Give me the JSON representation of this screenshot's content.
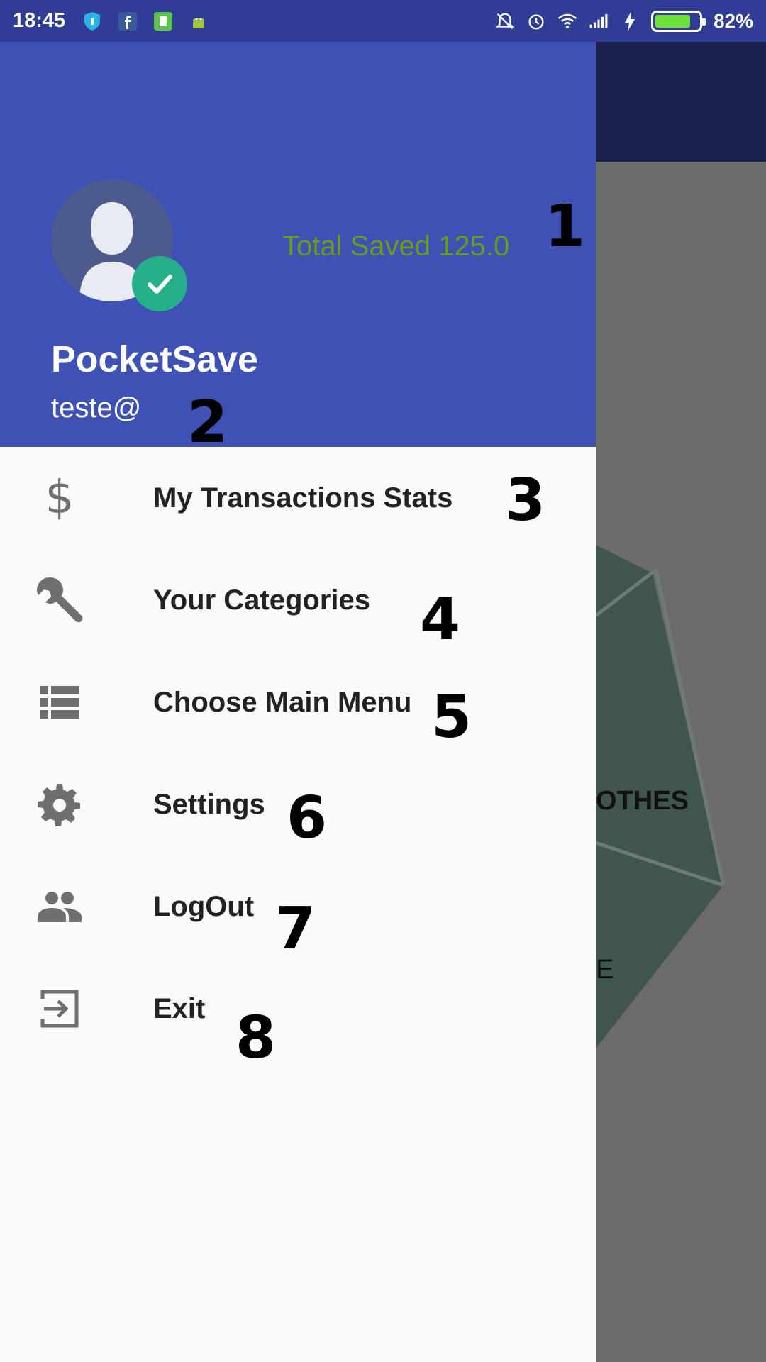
{
  "status_bar": {
    "time": "18:45",
    "battery_percent": "82%",
    "battery_level": 0.82,
    "left_icons": [
      "shield-icon",
      "facebook-icon",
      "sim-icon",
      "android-icon"
    ],
    "right_icons": [
      "alarm-off-icon",
      "alarm-icon",
      "wifi-icon",
      "signal-icon",
      "charging-icon",
      "battery-icon"
    ]
  },
  "header": {
    "total_saved": "Total Saved 125.0",
    "app_name": "PocketSave",
    "email": "teste@"
  },
  "menu": {
    "items": [
      {
        "label": "My Transactions Stats",
        "icon": "dollar-icon"
      },
      {
        "label": "Your Categories",
        "icon": "wrench-icon"
      },
      {
        "label": "Choose Main Menu",
        "icon": "list-icon"
      },
      {
        "label": "Settings",
        "icon": "gear-icon"
      },
      {
        "label": "LogOut",
        "icon": "people-icon"
      },
      {
        "label": "Exit",
        "icon": "exit-icon"
      }
    ]
  },
  "annotations": [
    "1",
    "2",
    "3",
    "4",
    "5",
    "6",
    "7",
    "8"
  ],
  "background": {
    "text1": "OTHES",
    "text2": "E"
  },
  "colors": {
    "header": "#3f51b5",
    "status_bar": "#2f3d96",
    "total_saved": "#6e9a1c",
    "verified": "#25b08a"
  }
}
